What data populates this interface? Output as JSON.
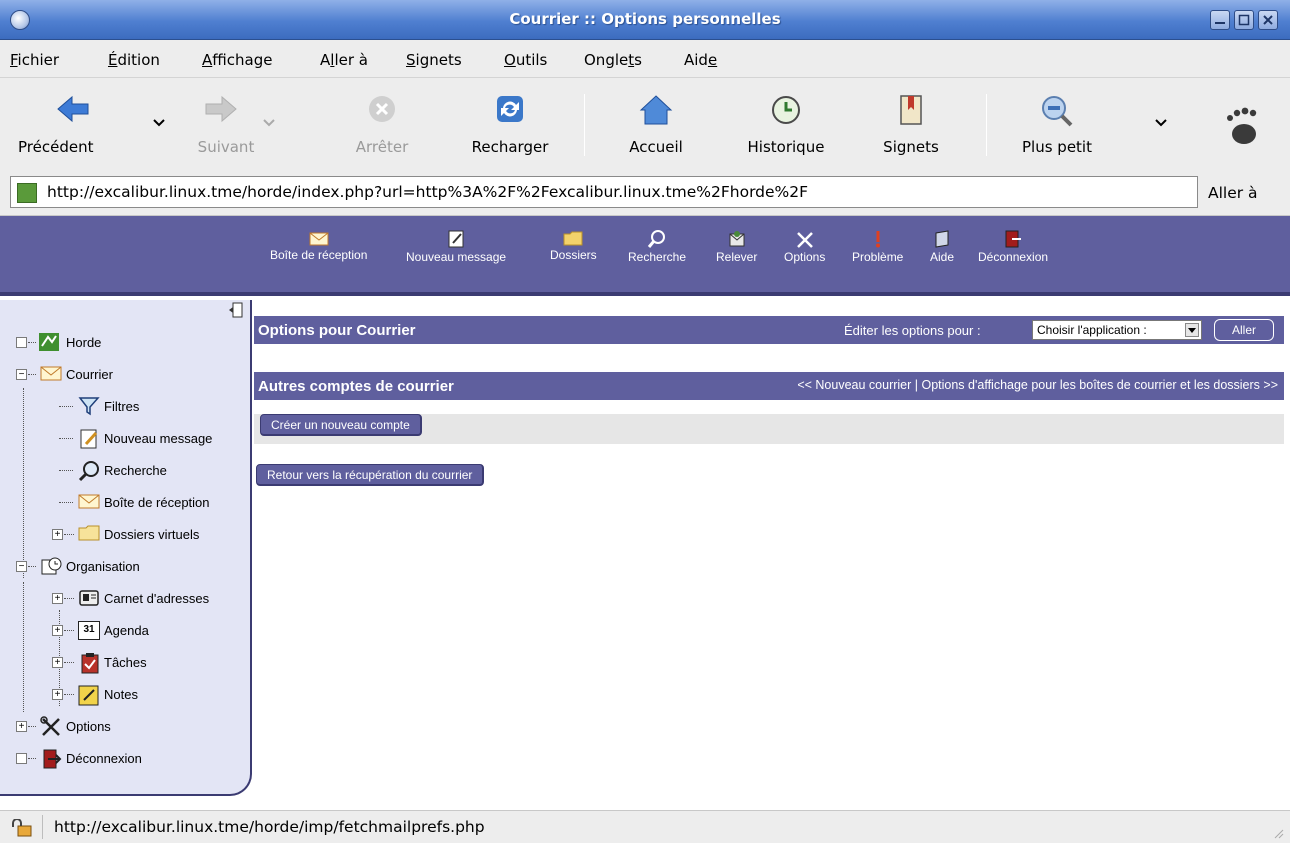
{
  "window": {
    "title": "Courrier :: Options personnelles"
  },
  "menubar": {
    "items": [
      {
        "pre": "",
        "u": "F",
        "post": "ichier"
      },
      {
        "pre": "",
        "u": "É",
        "post": "dition"
      },
      {
        "pre": "",
        "u": "A",
        "post": "ffichage"
      },
      {
        "pre": "A",
        "u": "l",
        "post": "ler à"
      },
      {
        "pre": "",
        "u": "S",
        "post": "ignets"
      },
      {
        "pre": "",
        "u": "O",
        "post": "utils"
      },
      {
        "pre": "Ongle",
        "u": "t",
        "post": "s"
      },
      {
        "pre": "Aid",
        "u": "e",
        "post": ""
      }
    ]
  },
  "toolbar": {
    "back": "Précédent",
    "forward": "Suivant",
    "stop": "Arrêter",
    "reload": "Recharger",
    "home": "Accueil",
    "history": "Historique",
    "bookmarks": "Signets",
    "zoom_out": "Plus petit"
  },
  "location": {
    "url": "http://excalibur.linux.tme/horde/index.php?url=http%3A%2F%2Fexcalibur.linux.tme%2Fhorde%2F",
    "go": "Aller à"
  },
  "horde_menu": {
    "inbox": "Boîte de réception",
    "new_message": "Nouveau message",
    "folders": "Dossiers",
    "search": "Recherche",
    "fetch": "Relever",
    "options": "Options",
    "problem": "Problème",
    "help": "Aide",
    "logout": "Déconnexion"
  },
  "sidebar": {
    "horde": "Horde",
    "courrier": "Courrier",
    "filtres": "Filtres",
    "nouveau_message": "Nouveau message",
    "recherche": "Recherche",
    "boite": "Boîte de réception",
    "dossiers_virtuels": "Dossiers virtuels",
    "organisation": "Organisation",
    "carnet": "Carnet d'adresses",
    "agenda": "Agenda",
    "agenda_day": "31",
    "taches": "Tâches",
    "notes": "Notes",
    "options": "Options",
    "deconnexion": "Déconnexion"
  },
  "main": {
    "options_title": "Options pour Courrier",
    "edit_label": "Éditer les options pour :",
    "app_select": "Choisir l'application :",
    "aller": "Aller",
    "section_title": "Autres comptes de courrier",
    "nav_links": "<< Nouveau courrier | Options d'affichage pour les boîtes de courrier et les dossiers >>",
    "create_button": "Créer un nouveau compte",
    "return_button": "Retour vers la récupération du courrier"
  },
  "status": {
    "text": "http://excalibur.linux.tme/horde/imp/fetchmailprefs.php"
  },
  "colors": {
    "horde_bar": "#5f5f9e",
    "sidebar_bg": "#e3e5f5",
    "title_bar": "#4f7fd0"
  }
}
